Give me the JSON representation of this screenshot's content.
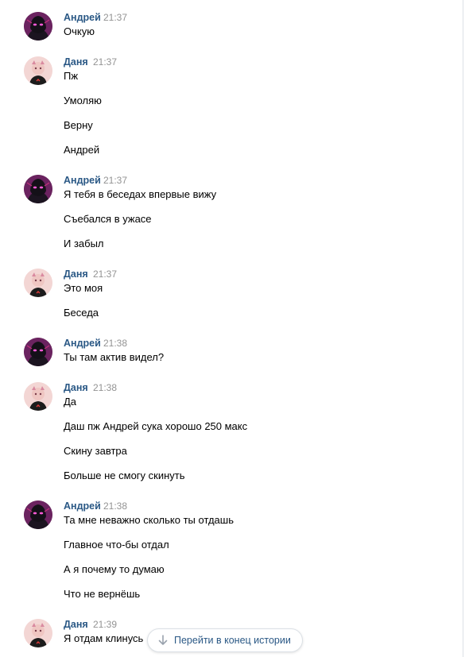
{
  "jump_button": {
    "label": "Перейти в конец истории",
    "icon": "arrow-down-icon"
  },
  "colors": {
    "author": "#2a5885",
    "time": "#939393",
    "text": "#000000",
    "border": "#dce1e6"
  },
  "messages": [
    {
      "author": "Андрей",
      "time": "21:37",
      "lines": [
        "Очкую"
      ]
    },
    {
      "author": "Даня",
      "time": "21:37",
      "lines": [
        "Пж",
        "Умоляю",
        "Верну",
        "Андрей"
      ]
    },
    {
      "author": "Андрей",
      "time": "21:37",
      "lines": [
        "Я тебя в беседах впервые вижу",
        "Съебался в ужасе",
        "И забыл"
      ]
    },
    {
      "author": "Даня",
      "time": "21:37",
      "lines": [
        "Это моя",
        "Беседа"
      ]
    },
    {
      "author": "Андрей",
      "time": "21:38",
      "lines": [
        "Ты там актив видел?"
      ]
    },
    {
      "author": "Даня",
      "time": "21:38",
      "lines": [
        "Да",
        "Даш пж Андрей сука хорошо 250 макс",
        "Скину завтра",
        "Больше не смогу скинуть"
      ]
    },
    {
      "author": "Андрей",
      "time": "21:38",
      "lines": [
        "Та мне неважно сколько ты отдашь",
        "Главное что-бы отдал",
        "А я почему то думаю",
        "Что не вернёшь"
      ]
    },
    {
      "author": "Даня",
      "time": "21:39",
      "lines": [
        "Я отдам клинусь"
      ]
    }
  ]
}
